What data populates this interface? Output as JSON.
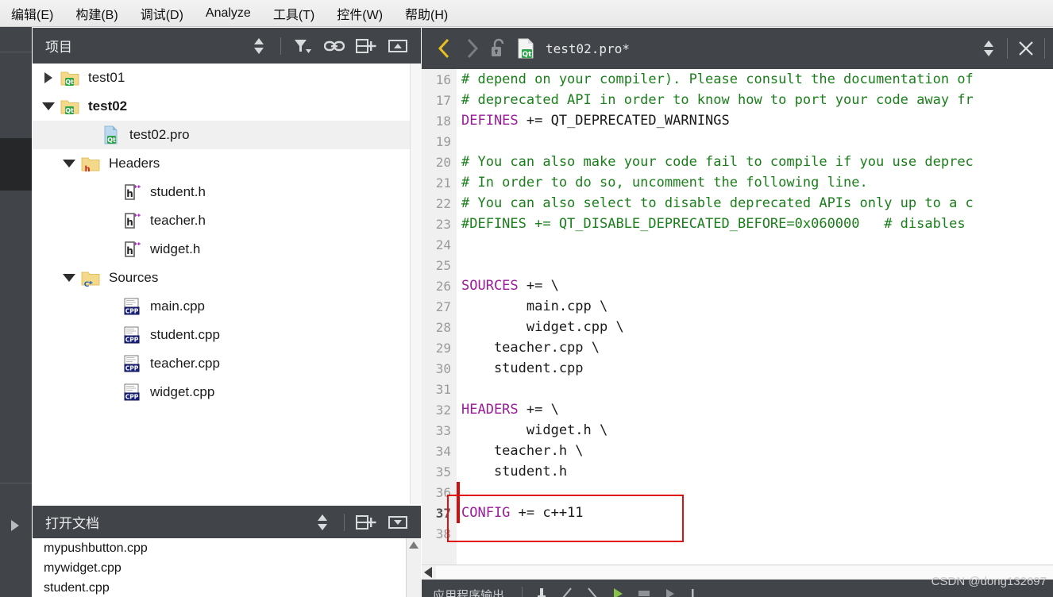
{
  "menubar": {
    "items": [
      {
        "label": "编辑(E)",
        "mnemonic": "E"
      },
      {
        "label": "构建(B)",
        "mnemonic": "B"
      },
      {
        "label": "调试(D)",
        "mnemonic": "D"
      },
      {
        "label": "Analyze",
        "mnemonic": "A"
      },
      {
        "label": "工具(T)",
        "mnemonic": "T"
      },
      {
        "label": "控件(W)",
        "mnemonic": "W"
      },
      {
        "label": "帮助(H)",
        "mnemonic": "H"
      }
    ]
  },
  "project_panel": {
    "title": "项目",
    "tools": [
      {
        "name": "sync-updown-icon"
      },
      {
        "name": "filter-icon"
      },
      {
        "name": "link-icon"
      },
      {
        "name": "split-add-icon"
      },
      {
        "name": "minimize-icon"
      }
    ],
    "tree": [
      {
        "label": "test01",
        "depth": 0,
        "icon": "qt-folder-icon",
        "expander": "collapsed",
        "selected": false,
        "bold": false
      },
      {
        "label": "test02",
        "depth": 0,
        "icon": "qt-folder-icon",
        "expander": "expanded",
        "selected": false,
        "bold": true
      },
      {
        "label": "test02.pro",
        "depth": 2,
        "icon": "qt-pro-file-icon",
        "expander": "none",
        "selected": true,
        "bold": false
      },
      {
        "label": "Headers",
        "depth": 1,
        "icon": "h-folder-icon",
        "expander": "expanded",
        "selected": false,
        "bold": false
      },
      {
        "label": "student.h",
        "depth": 3,
        "icon": "h-file-icon",
        "expander": "none",
        "selected": false,
        "bold": false
      },
      {
        "label": "teacher.h",
        "depth": 3,
        "icon": "h-file-icon",
        "expander": "none",
        "selected": false,
        "bold": false
      },
      {
        "label": "widget.h",
        "depth": 3,
        "icon": "h-file-icon",
        "expander": "none",
        "selected": false,
        "bold": false
      },
      {
        "label": "Sources",
        "depth": 1,
        "icon": "cpp-folder-icon",
        "expander": "expanded",
        "selected": false,
        "bold": false
      },
      {
        "label": "main.cpp",
        "depth": 3,
        "icon": "cpp-file-icon",
        "expander": "none",
        "selected": false,
        "bold": false
      },
      {
        "label": "student.cpp",
        "depth": 3,
        "icon": "cpp-file-icon",
        "expander": "none",
        "selected": false,
        "bold": false
      },
      {
        "label": "teacher.cpp",
        "depth": 3,
        "icon": "cpp-file-icon",
        "expander": "none",
        "selected": false,
        "bold": false
      },
      {
        "label": "widget.cpp",
        "depth": 3,
        "icon": "cpp-file-icon",
        "expander": "none",
        "selected": false,
        "bold": false
      }
    ]
  },
  "open_documents": {
    "title": "打开文档",
    "tools": [
      {
        "name": "sync-updown-icon"
      },
      {
        "name": "split-add-icon"
      },
      {
        "name": "collapse-icon"
      }
    ],
    "files": [
      "mypushbutton.cpp",
      "mywidget.cpp",
      "student.cpp"
    ]
  },
  "editor": {
    "filename": "test02.pro*",
    "toolbar": [
      {
        "name": "back-arrow-icon",
        "state": "enabled"
      },
      {
        "name": "forward-arrow-icon",
        "state": "disabled"
      },
      {
        "name": "unlock-icon",
        "state": "enabled"
      },
      {
        "name": "qt-pro-file-icon",
        "state": "enabled"
      }
    ],
    "right_tools": [
      {
        "name": "sync-updown-icon"
      },
      {
        "name": "close-icon"
      }
    ],
    "first_line_number": 16,
    "current_line": 37,
    "highlight_box": {
      "color": "#e01010",
      "from_line": 37,
      "to_line": 38
    },
    "change_marker": {
      "color": "#d01010",
      "from_line": 36,
      "to_line": 37
    },
    "lines": [
      {
        "n": 16,
        "segments": [
          {
            "t": "# depend on your compiler). Please consult the documentation of",
            "c": "cm"
          }
        ]
      },
      {
        "n": 17,
        "segments": [
          {
            "t": "# deprecated API in order to know how to port your code away fr",
            "c": "cm"
          }
        ]
      },
      {
        "n": 18,
        "segments": [
          {
            "t": "DEFINES",
            "c": "kw"
          },
          {
            "t": " += QT_DEPRECATED_WARNINGS",
            "c": ""
          }
        ]
      },
      {
        "n": 19,
        "segments": [
          {
            "t": "",
            "c": ""
          }
        ]
      },
      {
        "n": 20,
        "segments": [
          {
            "t": "# You can also make your code fail to compile if you use deprec",
            "c": "cm"
          }
        ]
      },
      {
        "n": 21,
        "segments": [
          {
            "t": "# In order to do so, uncomment the following line.",
            "c": "cm"
          }
        ]
      },
      {
        "n": 22,
        "segments": [
          {
            "t": "# You can also select to disable deprecated APIs only up to a c",
            "c": "cm"
          }
        ]
      },
      {
        "n": 23,
        "segments": [
          {
            "t": "#DEFINES += QT_DISABLE_DEPRECATED_BEFORE=0x060000   # disables",
            "c": "cm"
          }
        ]
      },
      {
        "n": 24,
        "segments": [
          {
            "t": "",
            "c": ""
          }
        ]
      },
      {
        "n": 25,
        "segments": [
          {
            "t": "",
            "c": ""
          }
        ]
      },
      {
        "n": 26,
        "segments": [
          {
            "t": "SOURCES",
            "c": "kw"
          },
          {
            "t": " += \\",
            "c": ""
          }
        ]
      },
      {
        "n": 27,
        "segments": [
          {
            "t": "        main.cpp \\",
            "c": ""
          }
        ]
      },
      {
        "n": 28,
        "segments": [
          {
            "t": "        widget.cpp \\",
            "c": ""
          }
        ]
      },
      {
        "n": 29,
        "segments": [
          {
            "t": "    teacher.cpp \\",
            "c": ""
          }
        ]
      },
      {
        "n": 30,
        "segments": [
          {
            "t": "    student.cpp",
            "c": ""
          }
        ]
      },
      {
        "n": 31,
        "segments": [
          {
            "t": "",
            "c": ""
          }
        ]
      },
      {
        "n": 32,
        "segments": [
          {
            "t": "HEADERS",
            "c": "kw"
          },
          {
            "t": " += \\",
            "c": ""
          }
        ]
      },
      {
        "n": 33,
        "segments": [
          {
            "t": "        widget.h \\",
            "c": ""
          }
        ]
      },
      {
        "n": 34,
        "segments": [
          {
            "t": "    teacher.h \\",
            "c": ""
          }
        ]
      },
      {
        "n": 35,
        "segments": [
          {
            "t": "    student.h",
            "c": ""
          }
        ]
      },
      {
        "n": 36,
        "segments": [
          {
            "t": "",
            "c": ""
          }
        ]
      },
      {
        "n": 37,
        "segments": [
          {
            "t": "CONFIG",
            "c": "kw"
          },
          {
            "t": " += c++11",
            "c": ""
          }
        ]
      },
      {
        "n": 38,
        "segments": [
          {
            "t": "",
            "c": ""
          }
        ]
      }
    ]
  },
  "bottom_bar": {
    "label": "应用程序输出",
    "tools": [
      {
        "name": "stop-icon"
      },
      {
        "name": "prev-icon"
      },
      {
        "name": "next-icon"
      },
      {
        "name": "run-icon"
      },
      {
        "name": "halt-icon"
      },
      {
        "name": "step-icon"
      },
      {
        "name": "bar-icon"
      }
    ]
  },
  "watermark": "CSDN @dong132697",
  "colors": {
    "panel_header": "#414549",
    "rail": "#414549",
    "rail_active": "#262729",
    "comment": "#1a7f1a",
    "keyword": "#9b1b9b",
    "accent_red": "#e01010",
    "accent_yellow": "#e8c020"
  }
}
